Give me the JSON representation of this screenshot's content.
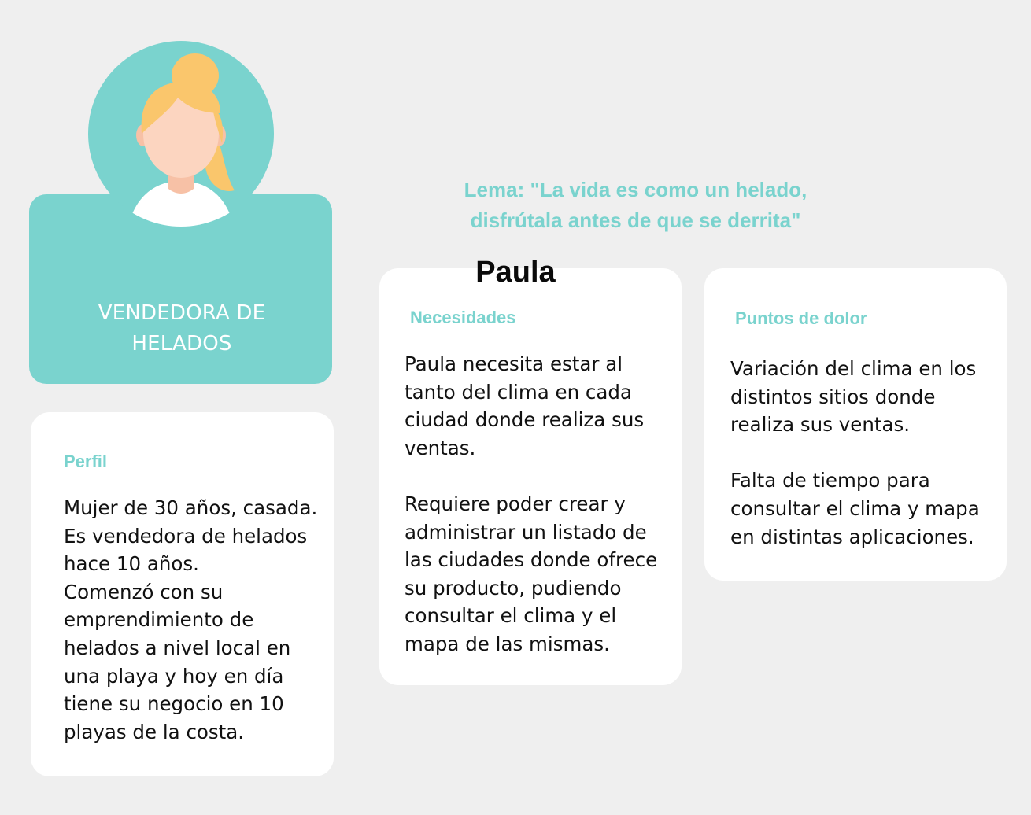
{
  "persona": {
    "name": "Paula",
    "role_line1": "VENDEDORA DE",
    "role_line2": "HELADOS"
  },
  "motto": {
    "line1": "Lema: \"La vida es como un helado,",
    "line2": "disfrútala antes de que se derrita\""
  },
  "profile": {
    "title": "Perfil",
    "body": "Mujer de 30 años, casada.\nEs vendedora de helados\nhace 10 años.\nComenzó con su\nemprendimiento de\nhelados a nivel local en\nuna playa y hoy en día\ntiene su negocio en 10\nplayas de la costa."
  },
  "needs": {
    "title": "Necesidades",
    "body": "Paula necesita estar al\ntanto del clima en cada\nciudad donde realiza sus\nventas.\n\nRequiere poder crear y\nadministrar un listado de\nlas ciudades donde ofrece\nsu producto, pudiendo\nconsultar el clima y el\nmapa de las mismas."
  },
  "pain_points": {
    "title": "Puntos de dolor",
    "body": "Variación del clima en los\ndistintos sitios donde\nrealiza sus ventas.\n\nFalta de tiempo para\nconsultar el clima y mapa\nen distintas aplicaciones."
  },
  "colors": {
    "accent": "#7ad3ce",
    "background": "#efefef",
    "card": "#ffffff",
    "hair": "#fac66c",
    "skin": "#fcd5c0"
  },
  "icons": {
    "avatar": "woman-avatar-icon"
  }
}
